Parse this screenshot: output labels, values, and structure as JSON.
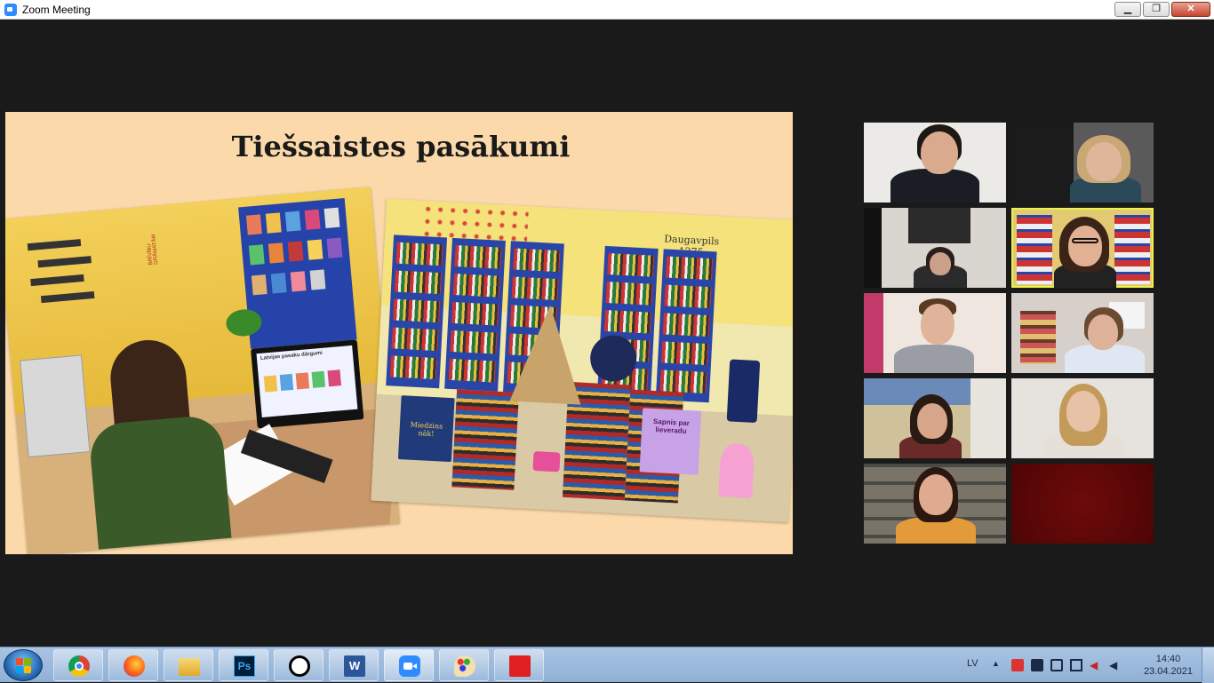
{
  "window": {
    "title": "Zoom Meeting",
    "minimize_label": "▁",
    "restore_label": "❐",
    "close_label": "✕"
  },
  "slide": {
    "title": "Tiešsaistes pasākumi",
    "left_photo": {
      "screen_heading": "Latvijas pasaku dārgumi",
      "wall_sign": "BRĪVĪBU GRĀMATĀM"
    },
    "right_photo": {
      "wall_sign": "Daugavpils 1275",
      "book_left": "Miedzins nāk!",
      "book_right": "Sapnis par lieveradu"
    }
  },
  "participants": [
    {
      "id": "p1",
      "active": false,
      "bg": "#eceae6",
      "hair": "#1e1814",
      "skin": "#d9aa8e",
      "shirt": "#1a1d24"
    },
    {
      "id": "p2",
      "active": false,
      "bg": "#1b1b1b",
      "hair": "#c9a876",
      "skin": "#e0b69a",
      "shirt": "#2a4a5a"
    },
    {
      "id": "p3",
      "active": false,
      "bg": "#d9d6d0",
      "hair": "#2a1f1a",
      "skin": "#caa08a",
      "shirt": "#2b2b2b"
    },
    {
      "id": "p4",
      "active": true,
      "bg": "#e3c971",
      "hair": "#3a2418",
      "skin": "#e2b093",
      "shirt": "#222222"
    },
    {
      "id": "p5",
      "active": false,
      "bg": "#efe7df",
      "hair": "#5a3a22",
      "skin": "#e0b49a",
      "shirt": "#9a9ea4"
    },
    {
      "id": "p6",
      "active": false,
      "bg": "#d7cfc9",
      "hair": "#6a4a30",
      "skin": "#deb298",
      "shirt": "#dfe8f2"
    },
    {
      "id": "p7",
      "active": false,
      "bg": "#cfc29a",
      "hair": "#2a1a14",
      "skin": "#d7a58a",
      "shirt": "#6a2a2a"
    },
    {
      "id": "p8",
      "active": false,
      "bg": "#e6e3df",
      "hair": "#c49a5a",
      "skin": "#e8c2a6",
      "shirt": "#e6e0d8"
    },
    {
      "id": "p9",
      "active": false,
      "bg": "#5a5246",
      "hair": "#2a1810",
      "skin": "#e0aa8e",
      "shirt": "#e29a3a"
    },
    {
      "id": "p10",
      "active": false,
      "bg": "#5e0707",
      "hair": "",
      "skin": "",
      "shirt": ""
    }
  ],
  "taskbar": {
    "apps": [
      {
        "name": "chrome-icon"
      },
      {
        "name": "firefox-icon"
      },
      {
        "name": "file-explorer-icon"
      },
      {
        "name": "photoshop-icon",
        "label": "Ps"
      },
      {
        "name": "inkscape-icon"
      },
      {
        "name": "word-icon",
        "label": "W"
      },
      {
        "name": "zoom-icon"
      },
      {
        "name": "paint-icon"
      },
      {
        "name": "acrobat-icon"
      }
    ],
    "language": "LV",
    "time": "14:40",
    "date": "23.04.2021"
  }
}
